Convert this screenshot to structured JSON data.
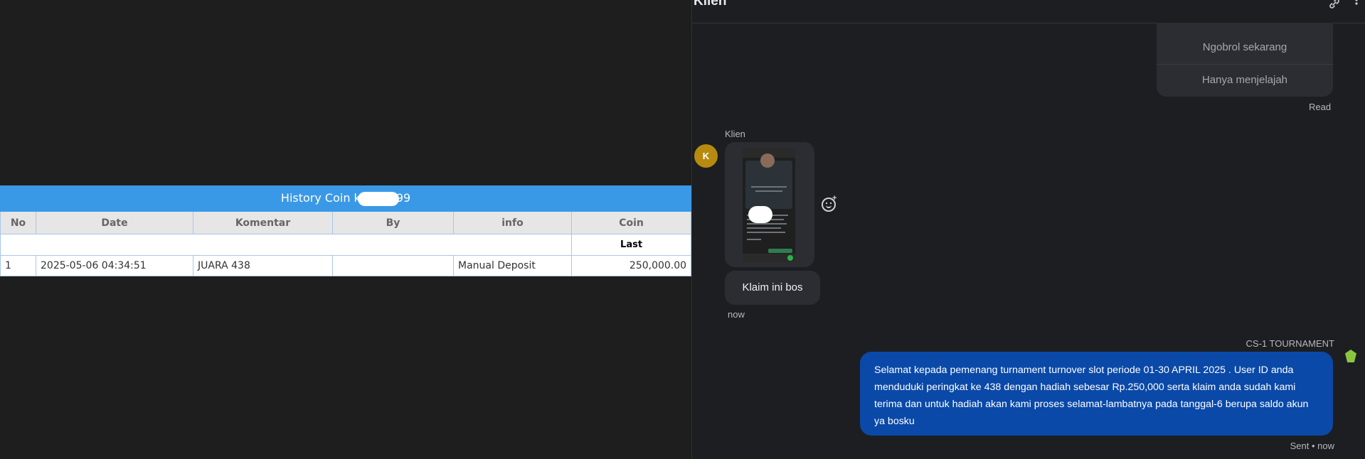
{
  "history": {
    "title_prefix": "History Coin k",
    "title_suffix": "99",
    "columns": [
      "No",
      "Date",
      "Komentar",
      "By",
      "info",
      "Coin"
    ],
    "last_label": "Last",
    "rows": [
      {
        "no": "1",
        "date": "2025-05-06 04:34:51",
        "komentar": "JUARA 438",
        "by": "",
        "info": "Manual Deposit",
        "coin": "250,000.00"
      }
    ]
  },
  "chat": {
    "title": "Klien",
    "options": [
      "Ngobrol sekarang",
      "Hanya menjelajah"
    ],
    "read_status": "Read",
    "client": {
      "name": "Klien",
      "avatar_letter": "K",
      "message": "Klaim ini bos",
      "time": "now"
    },
    "agent": {
      "name": "CS-1 TOURNAMENT",
      "message": "Selamat kepada pemenang turnament turnover slot periode 01-30 APRIL 2025 . User ID anda menduduki peringkat ke 438 dengan hadiah sebesar Rp.250,000 serta klaim anda sudah kami terima dan untuk hadiah akan kami proses selamat-lambatnya pada tanggal-6 berupa saldo akun ya bosku",
      "status": "Sent • now"
    }
  },
  "colors": {
    "table_header": "#3a99e6",
    "coin_value": "#1a8a1a",
    "sent_bubble": "#0a49a8",
    "client_avatar": "#b78a10",
    "chat_bg": "#1d1e22"
  },
  "icons": {
    "header_link": "link-icon",
    "header_more": "more-icon",
    "reaction": "add-reaction-icon"
  }
}
